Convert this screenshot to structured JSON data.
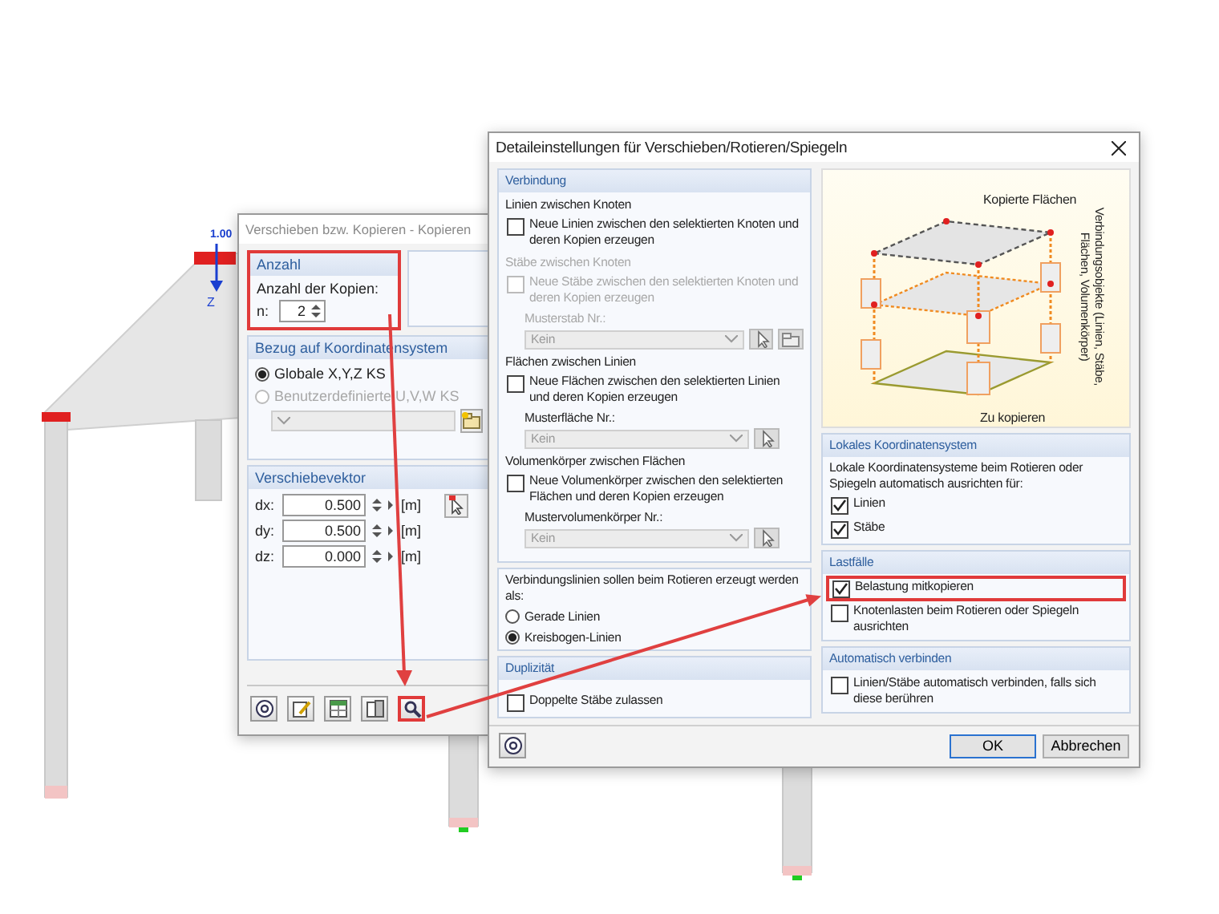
{
  "viewport": {
    "dimension_label": "1.00",
    "axis_label": "Z"
  },
  "copy_dialog": {
    "title": "Verschieben bzw. Kopieren - Kopieren",
    "count_group": {
      "title": "Anzahl",
      "label": "Anzahl der Kopien:",
      "n_label": "n:",
      "value": "2",
      "highlighted": true
    },
    "coordinate_group": {
      "title": "Bezug auf Koordinatensystem",
      "options": [
        {
          "label": "Globale X,Y,Z KS",
          "selected": true,
          "disabled": false
        },
        {
          "label": "Benutzerdefinierte U,V,W KS",
          "selected": false,
          "disabled": true
        }
      ]
    },
    "vector_group": {
      "title": "Verschiebevektor",
      "rows": [
        {
          "label": "dx:",
          "value": "0.500",
          "unit": "[m]"
        },
        {
          "label": "dy:",
          "value": "0.500",
          "unit": "[m]"
        },
        {
          "label": "dz:",
          "value": "0.000",
          "unit": "[m]"
        }
      ]
    },
    "toolbar": [
      {
        "kind": "help",
        "highlighted": false
      },
      {
        "kind": "edit",
        "highlighted": false
      },
      {
        "kind": "table",
        "highlighted": false
      },
      {
        "kind": "view",
        "highlighted": false
      },
      {
        "kind": "search",
        "highlighted": true
      }
    ]
  },
  "detail_dialog": {
    "title": "Detaileinstellungen für Verschieben/Rotieren/Spiegeln",
    "connection": {
      "title": "Verbindung",
      "sections": [
        {
          "heading": "Linien zwischen Knoten",
          "disabled": false,
          "checkbox": {
            "label": "Neue Linien zwischen den selektierten Knoten und deren Kopien erzeugen",
            "checked": false
          }
        },
        {
          "heading": "Stäbe zwischen Knoten",
          "disabled": true,
          "checkbox": {
            "label": "Neue Stäbe zwischen den selektierten Knoten und deren Kopien erzeugen",
            "checked": false
          },
          "select": {
            "label": "Musterstab Nr.:",
            "value": "Kein"
          },
          "tools": [
            {
              "kind": "pick"
            },
            {
              "kind": "new"
            }
          ]
        },
        {
          "heading": "Flächen zwischen Linien",
          "disabled": false,
          "checkbox": {
            "label": "Neue Flächen zwischen den selektierten Linien und deren Kopien erzeugen",
            "checked": false
          },
          "select": {
            "label": "Musterfläche Nr.:",
            "value": "Kein"
          },
          "tools": [
            {
              "kind": "pick"
            }
          ]
        },
        {
          "heading": "Volumenkörper zwischen Flächen",
          "disabled": false,
          "checkbox": {
            "label": "Neue Volumenkörper zwischen den selektierten Flächen und deren Kopien erzeugen",
            "checked": false
          },
          "select": {
            "label": "Mustervolumenkörper Nr.:",
            "value": "Kein"
          },
          "tools": [
            {
              "kind": "pick"
            }
          ]
        }
      ]
    },
    "rotation": {
      "label": "Verbindungslinien sollen beim Rotieren erzeugt werden als:",
      "options": [
        {
          "label": "Gerade Linien",
          "selected": false
        },
        {
          "label": "Kreisbogen-Linien",
          "selected": true
        }
      ]
    },
    "duplicity": {
      "title": "Duplizität",
      "checkboxes": [
        {
          "label": "Doppelte Stäbe zulassen",
          "checked": false,
          "highlighted": false
        }
      ]
    },
    "illustration": {
      "top_label": "Kopierte Flächen",
      "side_label": "Verbindungsobjekte (Linien, Stäbe, Flächen, Volumenkörper)",
      "bottom_label": "Zu kopieren"
    },
    "local_cs": {
      "title": "Lokales Koordinatensystem",
      "text": "Lokale Koordinatensysteme beim Rotieren oder Spiegeln automatisch ausrichten für:",
      "checkboxes": [
        {
          "label": "Linien",
          "checked": true,
          "highlighted": false
        },
        {
          "label": "Stäbe",
          "checked": true,
          "highlighted": false
        }
      ]
    },
    "load_cases": {
      "title": "Lastfälle",
      "checkboxes": [
        {
          "label": "Belastung mitkopieren",
          "checked": true,
          "highlighted": true
        },
        {
          "label": "Knotenlasten beim Rotieren oder Spiegeln ausrichten",
          "checked": false,
          "highlighted": false
        }
      ]
    },
    "auto_connect": {
      "title": "Automatisch verbinden",
      "checkboxes": [
        {
          "label": "Linien/Stäbe automatisch verbinden, falls sich diese berühren",
          "checked": false,
          "highlighted": false
        }
      ]
    },
    "buttons": [
      {
        "label": "OK",
        "kind": "default"
      },
      {
        "label": "Abbrechen",
        "kind": "normal"
      }
    ]
  }
}
